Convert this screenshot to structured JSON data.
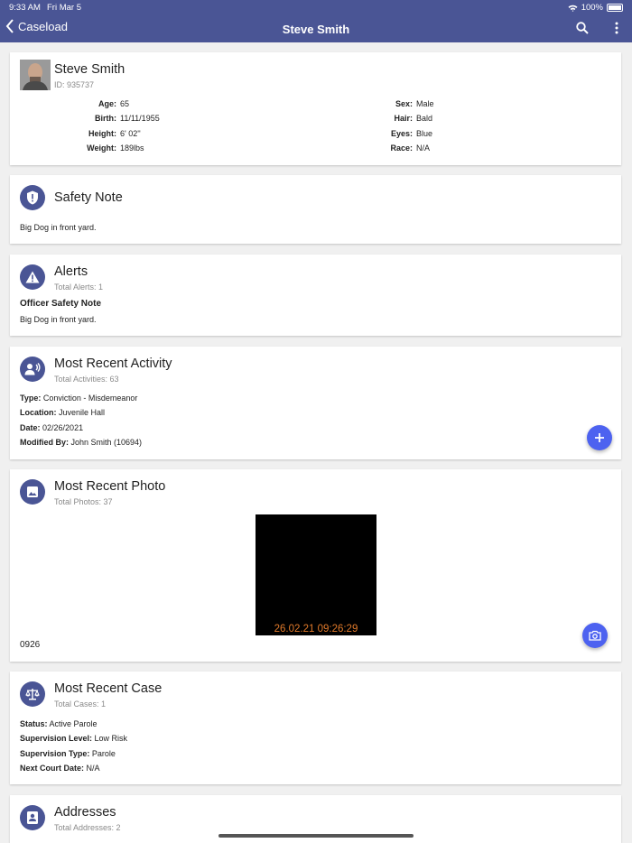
{
  "status": {
    "time": "9:33 AM",
    "date": "Fri Mar 5",
    "battery": "100%"
  },
  "nav": {
    "back_label": "Caseload",
    "title": "Steve  Smith"
  },
  "profile": {
    "name": "Steve  Smith",
    "id": "ID: 935737",
    "left": [
      {
        "k": "Age:",
        "v": "65"
      },
      {
        "k": "Birth:",
        "v": "11/11/1955"
      },
      {
        "k": "Height:",
        "v": "6' 02''"
      },
      {
        "k": "Weight:",
        "v": "189lbs"
      }
    ],
    "right": [
      {
        "k": "Sex:",
        "v": "Male"
      },
      {
        "k": "Hair:",
        "v": "Bald"
      },
      {
        "k": "Eyes:",
        "v": "Blue"
      },
      {
        "k": "Race:",
        "v": "N/A"
      }
    ]
  },
  "safety": {
    "title": "Safety Note",
    "text": "Big Dog in front yard."
  },
  "alerts": {
    "title": "Alerts",
    "sub": "Total Alerts: 1",
    "item_title": "Officer Safety Note",
    "item_text": "Big Dog in front yard."
  },
  "activity": {
    "title": "Most Recent Activity",
    "sub": "Total Activities: 63",
    "lines": [
      {
        "k": "Type:",
        "v": "Conviction - Misdemeanor"
      },
      {
        "k": "Location:",
        "v": "Juvenile Hall"
      },
      {
        "k": "Date:",
        "v": "02/26/2021"
      },
      {
        "k": "Modified By:",
        "v": "John Smith (10694)"
      }
    ]
  },
  "photo": {
    "title": "Most Recent Photo",
    "sub": "Total Photos: 37",
    "stamp": "26.02.21 09:26:29",
    "caption": "0926"
  },
  "case": {
    "title": "Most Recent Case",
    "sub": "Total Cases: 1",
    "lines": [
      {
        "k": "Status:",
        "v": "Active Parole"
      },
      {
        "k": "Supervision Level:",
        "v": "Low Risk"
      },
      {
        "k": "Supervision Type:",
        "v": "Parole"
      },
      {
        "k": "Next Court Date:",
        "v": "N/A"
      }
    ]
  },
  "addresses": {
    "title": "Addresses",
    "sub": "Total Addresses: 2"
  },
  "colors": {
    "header": "#4a5595",
    "fab": "#4d62f0",
    "stamp": "#e0792a"
  },
  "icons": {
    "header": [
      "back-chevron-icon",
      "search-icon",
      "more-vert-icon",
      "wifi-icon",
      "battery-icon"
    ],
    "cards": [
      "shield-icon",
      "warning-icon",
      "activity-person-icon",
      "image-icon",
      "scale-icon",
      "contact-card-icon",
      "plus-icon",
      "camera-icon"
    ]
  }
}
